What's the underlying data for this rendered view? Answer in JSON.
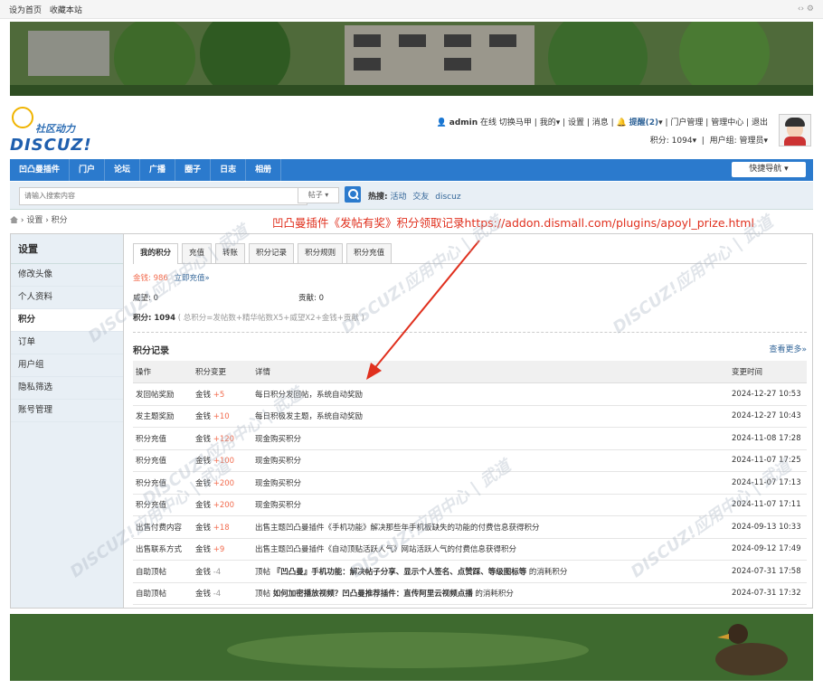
{
  "topbar": {
    "set_home": "设为首页",
    "bookmark": "收藏本站"
  },
  "logo": {
    "cn": "社区动力",
    "en": "DISCUZ!"
  },
  "user": {
    "name": "admin",
    "online": "在线",
    "switch": "切换马甲",
    "mine": "我的",
    "settings": "设置",
    "messages": "消息",
    "reminder": "提醒(2)",
    "portal_manage": "门户管理",
    "admin_center": "管理中心",
    "logout": "退出",
    "credits": "积分: 1094",
    "group": "用户组: 管理员"
  },
  "nav": {
    "items": [
      "凹凸曼插件",
      "门户",
      "论坛",
      "广播",
      "圈子",
      "日志",
      "相册"
    ],
    "quick": "快捷导航"
  },
  "search": {
    "placeholder": "请输入搜索内容",
    "type": "帖子",
    "hot_label": "热搜:",
    "hot": [
      "活动",
      "交友",
      "discuz"
    ]
  },
  "breadcrumb": {
    "items": [
      "设置",
      "积分"
    ]
  },
  "notice": "凹凸曼插件《发帖有奖》积分领取记录https://addon.dismall.com/plugins/apoyl_prize.html",
  "sidebar": {
    "title": "设置",
    "items": [
      "修改头像",
      "个人资料",
      "积分",
      "订单",
      "用户组",
      "隐私筛选",
      "账号管理"
    ]
  },
  "tabs": [
    "我的积分",
    "充值",
    "转账",
    "积分记录",
    "积分规则",
    "积分充值"
  ],
  "summary": {
    "money_label": "金钱: ",
    "money_value": "986",
    "recharge_link": "立即充值»",
    "prestige": "威望: 0",
    "contribution": "贡献: 0",
    "credits_label": "积分: ",
    "credits_value": "1094",
    "formula": "( 总积分=发帖数+精华帖数X5+威望X2+金钱+贡献 )"
  },
  "records": {
    "title": "积分记录",
    "more": "查看更多»",
    "headers": [
      "操作",
      "积分变更",
      "详情",
      "变更时间"
    ],
    "rows": [
      {
        "op": "发回帖奖励",
        "unit": "金钱",
        "change": "+5",
        "detail": "每日积分发回帖，系统自动奖励",
        "time": "2024-12-27 10:53"
      },
      {
        "op": "发主题奖励",
        "unit": "金钱",
        "change": "+10",
        "detail": "每日积极发主题，系统自动奖励",
        "time": "2024-12-27 10:43"
      },
      {
        "op": "积分充值",
        "unit": "金钱",
        "change": "+120",
        "detail": "现金购买积分",
        "time": "2024-11-08 17:28"
      },
      {
        "op": "积分充值",
        "unit": "金钱",
        "change": "+100",
        "detail": "现金购买积分",
        "time": "2024-11-07 17:25"
      },
      {
        "op": "积分充值",
        "unit": "金钱",
        "change": "+200",
        "detail": "现金购买积分",
        "time": "2024-11-07 17:13"
      },
      {
        "op": "积分充值",
        "unit": "金钱",
        "change": "+200",
        "detail": "现金购买积分",
        "time": "2024-11-07 17:11"
      },
      {
        "op": "出售付费内容",
        "unit": "金钱",
        "change": "+18",
        "detail": "出售主题凹凸曼插件《手机功能》解决那些年手机板缺失的功能的付费信息获得积分",
        "time": "2024-09-13 10:33"
      },
      {
        "op": "出售联系方式",
        "unit": "金钱",
        "change": "+9",
        "detail": "出售主题凹凸曼插件《自动顶贴活跃人气》网站活跃人气的付费信息获得积分",
        "time": "2024-09-12 17:49"
      },
      {
        "op": "自助顶帖",
        "unit": "金钱",
        "change": "-4",
        "detail_prefix": "顶帖 ",
        "detail_bold": "『凹凸曼』手机功能：解决帖子分享、显示个人签名、点赞踩、等级图标等",
        "detail_suffix": " 的消耗积分",
        "time": "2024-07-31 17:58"
      },
      {
        "op": "自助顶帖",
        "unit": "金钱",
        "change": "-4",
        "detail_prefix": "顶帖 ",
        "detail_bold": "如何加密播放视频？凹凸曼推荐插件：直传阿里云视频点播",
        "detail_suffix": " 的消耗积分",
        "time": "2024-07-31 17:32"
      }
    ]
  },
  "watermark": {
    "text": "DISCUZ!应用中心 | 武道",
    "sub": "addon.dismall.com"
  },
  "colors": {
    "nav": "#2b7acd",
    "accent_red": "#e0301e",
    "gain": "#f26c4f",
    "link": "#336699"
  }
}
